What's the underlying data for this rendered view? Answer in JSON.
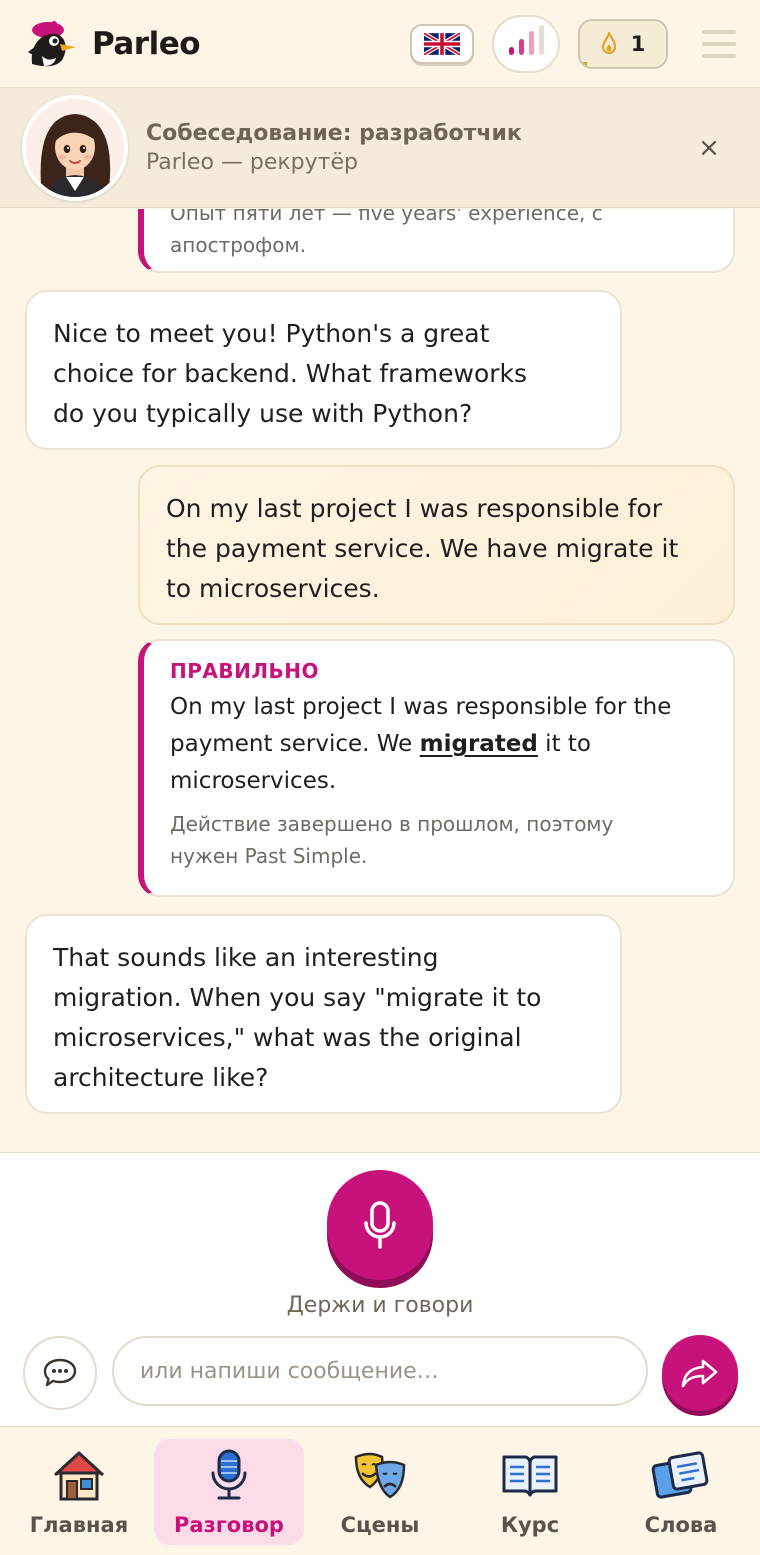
{
  "app": {
    "name": "Parleo"
  },
  "header": {
    "lang_icon": "uk-flag-icon",
    "streak_count": "1",
    "streak_progress": 0.08,
    "stats_icon": "bar-chart-icon",
    "menu_icon": "hamburger-menu-icon"
  },
  "scenario": {
    "title": "Собеседование: разработчик",
    "subtitle": "Parleo — рекрутёр",
    "close_label": "×"
  },
  "messages": {
    "partial_fix_top": "Опыт пяти лет — five years' experience, с",
    "partial_fix_bottom": "апострофом.",
    "bot_1_line1": "Nice to meet you! Python's a great",
    "bot_1_line2": "choice for backend. What frameworks",
    "bot_1_line3": "do you typically use with Python?",
    "user_1_line1": "On my last project I was responsible for",
    "user_1_line2": "the payment service. We have migrate it",
    "user_1_line3": "to microservices.",
    "fix_label": "ПРАВИЛЬНО",
    "fix_line1": "On my last project I was responsible for the",
    "fix_line2_pre": "payment service. We ",
    "fix_line2_word": "migrated",
    "fix_line2_post": " it to",
    "fix_line3": "microservices.",
    "fix_note_line1": "Действие завершено в прошлом, поэтому",
    "fix_note_line2": "нужен Past Simple.",
    "bot_2_line1": "That sounds like an interesting",
    "bot_2_line2": "migration. When you say \"migrate it to",
    "bot_2_line3": "microservices,\" what was the original",
    "bot_2_line4": "architecture like?"
  },
  "composer": {
    "mic_hint": "Держи и говори",
    "input_placeholder": "или напиши сообщение…",
    "mic_icon": "microphone-icon",
    "send_icon": "share-arrow-icon",
    "chat_icon": "speech-bubble-icon"
  },
  "nav": {
    "items": [
      {
        "label": "Главная",
        "icon": "home-icon",
        "active": false
      },
      {
        "label": "Разговор",
        "icon": "microphone-icon",
        "active": true
      },
      {
        "label": "Сцены",
        "icon": "theater-masks-icon",
        "active": false
      },
      {
        "label": "Курс",
        "icon": "book-icon",
        "active": false
      },
      {
        "label": "Слова",
        "icon": "flashcards-icon",
        "active": false
      }
    ]
  },
  "colors": {
    "accent": "#c7127b",
    "background": "#fdf6e6",
    "streak": "#e2a42b"
  }
}
